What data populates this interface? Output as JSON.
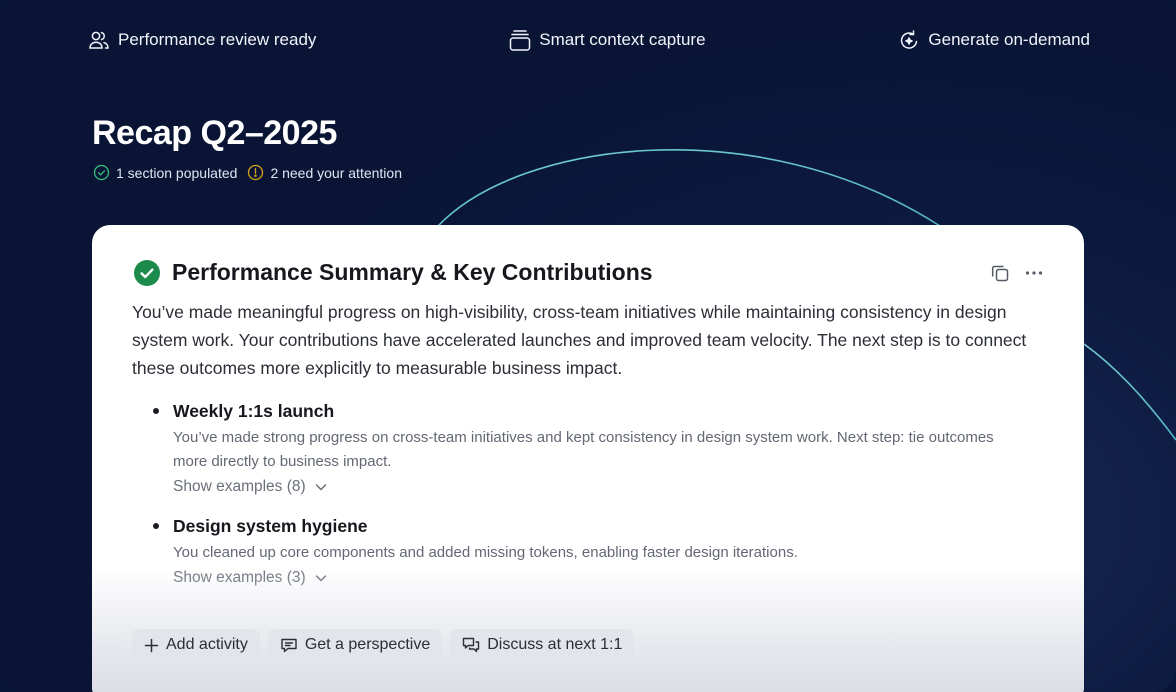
{
  "features": [
    {
      "label": "Performance review ready",
      "icon": "users-icon"
    },
    {
      "label": "Smart context capture",
      "icon": "stack-icon"
    },
    {
      "label": "Generate on-demand",
      "icon": "regenerate-icon"
    }
  ],
  "page": {
    "title": "Recap Q2–2025",
    "status_populated": "1 section populated",
    "status_attention": "2 need your attention"
  },
  "card": {
    "title": "Performance Summary & Key Contributions",
    "summary": "You’ve made meaningful progress on high-visibility, cross-team initiatives while maintaining consistency in design system work. Your contributions have accelerated launches and improved team velocity. The next step is to connect these outcomes more explicitly to measurable business impact.",
    "items": [
      {
        "title": "Weekly 1:1s launch",
        "description": "You’ve made strong progress on cross-team initiatives and kept consistency in design system work. Next step: tie outcomes more directly to business impact.",
        "more": "Show examples (8)"
      },
      {
        "title": "Design system hygiene",
        "description": "You cleaned up core components and added missing tokens, enabling faster design iterations.",
        "more": "Show examples (3)"
      }
    ],
    "actions": [
      {
        "label": "Add activity",
        "icon": "plus-icon"
      },
      {
        "label": "Get a perspective",
        "icon": "comment-icon"
      },
      {
        "label": "Discuss at next 1:1",
        "icon": "chat-bubbles-icon"
      }
    ]
  },
  "colors": {
    "background": "#0a1638",
    "accent_green": "#1c8a4a",
    "warning_amber": "#d9a21b",
    "arc_teal": "#6fd6d8"
  }
}
